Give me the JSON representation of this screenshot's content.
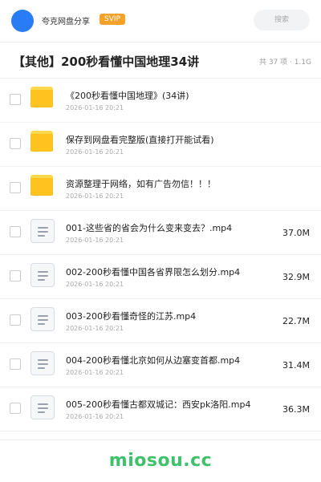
{
  "header": {
    "app_title": "夸克网盘分享",
    "badge": "SVIP",
    "search_placeholder": "搜索"
  },
  "folder": {
    "title": "【其他】200秒看懂中国地理34讲",
    "meta": "共 37 项 · 1.1G"
  },
  "items": [
    {
      "type": "folder",
      "icon": "folder-icon",
      "name": "《200秒看懂中国地理》(34讲)",
      "date": "2026-01-16 20:21",
      "size": ""
    },
    {
      "type": "folder",
      "icon": "folder-icon",
      "name": "保存到网盘看完整版(直接打开能试看)",
      "date": "2026-01-16 20:21",
      "size": ""
    },
    {
      "type": "folder",
      "icon": "folder-icon",
      "name": "资源整理于网络，如有广告勿信！！！",
      "date": "2026-01-16 20:21",
      "size": ""
    },
    {
      "type": "file",
      "icon": "file-icon",
      "name": "001-这些省的省会为什么变来变去？.mp4",
      "date": "2026-01-16 20:21",
      "size": "37.0M"
    },
    {
      "type": "file",
      "icon": "file-icon",
      "name": "002-200秒看懂中国各省界限怎么划分.mp4",
      "date": "2026-01-16 20:21",
      "size": "32.9M"
    },
    {
      "type": "file",
      "icon": "file-icon",
      "name": "003-200秒看懂奇怪的江苏.mp4",
      "date": "2026-01-16 20:21",
      "size": "22.7M"
    },
    {
      "type": "file",
      "icon": "file-icon",
      "name": "004-200秒看懂北京如何从边塞变首都.mp4",
      "date": "2026-01-16 20:21",
      "size": "31.4M"
    },
    {
      "type": "file",
      "icon": "file-icon",
      "name": "005-200秒看懂古都双城记：西安pk洛阳.mp4",
      "date": "2026-01-16 20:21",
      "size": "36.3M"
    }
  ],
  "watermark": "miosou.cc",
  "colors": {
    "accent": "#2a7cf6",
    "badge": "#f5a12a",
    "folder": "#ffc21f",
    "watermark": "#3ec16a"
  }
}
